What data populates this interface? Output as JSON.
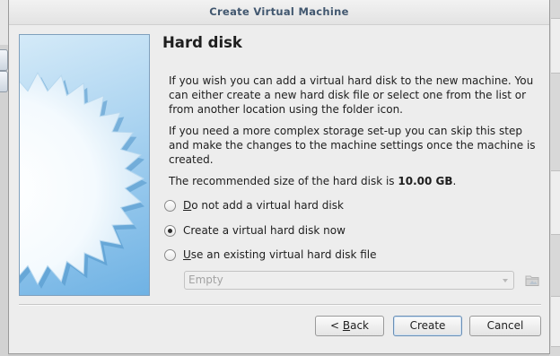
{
  "window": {
    "title": "Create Virtual Machine"
  },
  "page": {
    "heading": "Hard disk",
    "paragraph1": "If you wish you can add a virtual hard disk to the new machine. You can either create a new hard disk file or select one from the list or from another location using the folder icon.",
    "paragraph2": "If you need a more complex storage set-up you can skip this step and make the changes to the machine settings once the machine is created.",
    "recommended_prefix": "The recommended size of the hard disk is ",
    "recommended_size": "10.00 GB",
    "recommended_suffix": "."
  },
  "options": [
    {
      "mnemonic": "D",
      "rest": "o not add a virtual hard disk",
      "selected": false
    },
    {
      "mnemonic": "",
      "prefix": "C",
      "rest": "reate a virtual hard disk now",
      "selected": true
    },
    {
      "mnemonic": "U",
      "rest": "se an existing virtual hard disk file",
      "selected": false
    }
  ],
  "existing_disk_combo": {
    "value": "Empty",
    "enabled": false
  },
  "buttons": {
    "back_prefix": "< ",
    "back_mnemonic": "B",
    "back_rest": "ack",
    "create": "Create",
    "cancel": "Cancel"
  },
  "icons": {
    "banner": "starburst-disk-banner",
    "folder": "folder-icon",
    "dropdown": "chevron-down-icon"
  },
  "colors": {
    "title_text": "#41576f",
    "banner_blue": "#6fb2e4",
    "default_button_border": "#6b8fb5"
  }
}
